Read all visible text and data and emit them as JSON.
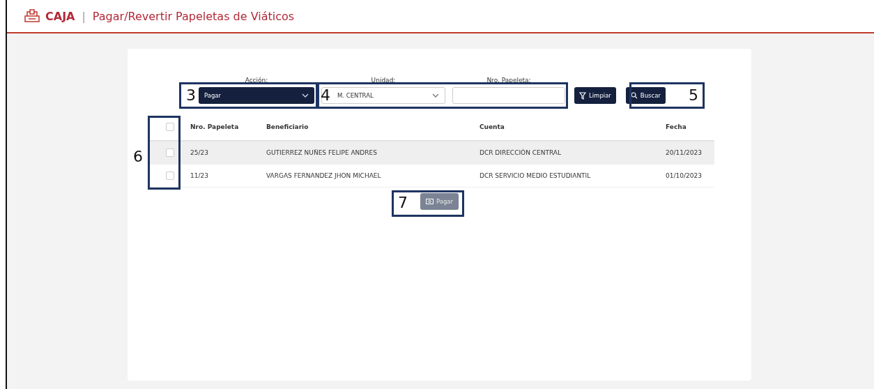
{
  "header": {
    "module": "CAJA",
    "separator": "|",
    "title": "Pagar/Revertir Papeletas de Viáticos"
  },
  "filters": {
    "accion": {
      "label": "Acción:",
      "value": "Pagar"
    },
    "unidad": {
      "label": "Unidad:",
      "value": "M. CENTRAL"
    },
    "papeleta": {
      "label": "Nro. Papeleta:"
    },
    "clear_button": "Limpiar",
    "search_button": "Buscar"
  },
  "table": {
    "select_all": {
      "checked": false
    },
    "columns": [
      "Nro. Papeleta",
      "Beneficiario",
      "Cuenta",
      "Fecha"
    ],
    "rows": [
      {
        "checked": false,
        "cells": [
          "25/23",
          "GUTIERREZ NUÑES FELIPE ANDRES",
          "DCR DIRECCIÓN CENTRAL",
          "20/11/2023"
        ]
      },
      {
        "checked": false,
        "cells": [
          "11/23",
          "VARGAS FERNANDEZ JHON MICHAEL",
          "DCR SERVICIO MEDIO ESTUDIANTIL",
          "01/10/2023"
        ]
      }
    ]
  },
  "action_button": {
    "label": "Pagar",
    "disabled": true
  },
  "annotations": [
    "3",
    "4",
    "5",
    "6",
    "7"
  ]
}
